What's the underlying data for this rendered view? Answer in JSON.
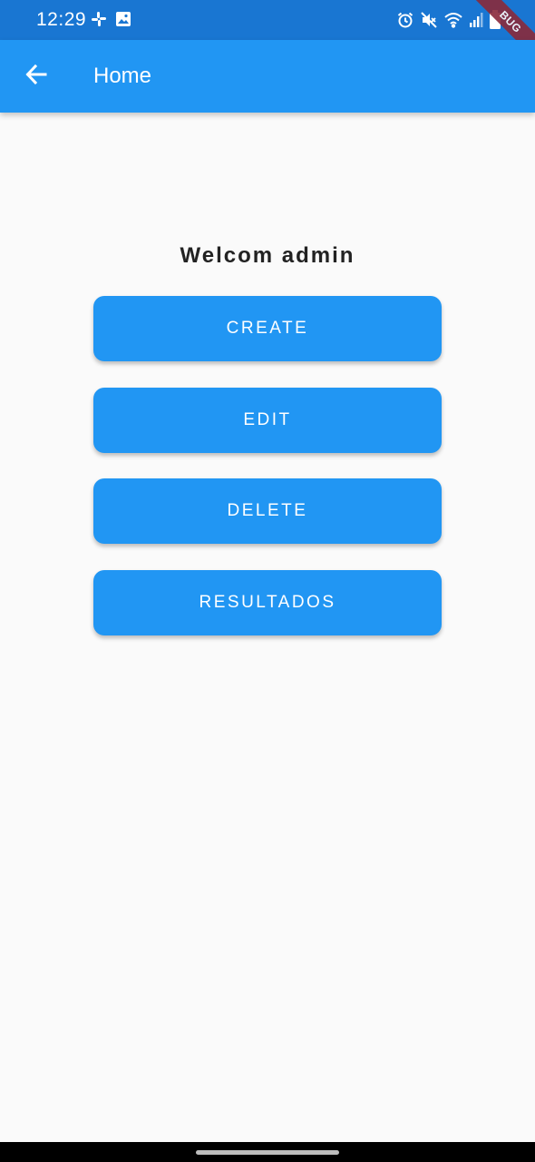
{
  "status_bar": {
    "time": "12:29",
    "left_icons": [
      "slack-icon",
      "image-icon"
    ],
    "right_icons": [
      "alarm-icon",
      "mute-icon",
      "wifi-icon",
      "signal-icon",
      "battery-icon"
    ]
  },
  "debug_banner": "BUG",
  "app_bar": {
    "back_icon": "arrow-back-icon",
    "title": "Home"
  },
  "main": {
    "welcome_text": "Welcom admin",
    "buttons": [
      {
        "label": "CREATE"
      },
      {
        "label": "EDIT"
      },
      {
        "label": "DELETE"
      },
      {
        "label": "RESULTADOS"
      }
    ]
  },
  "colors": {
    "status_bar": "#1976d2",
    "app_bar": "#2196f3",
    "button": "#2196f3",
    "background": "#fafafa"
  }
}
